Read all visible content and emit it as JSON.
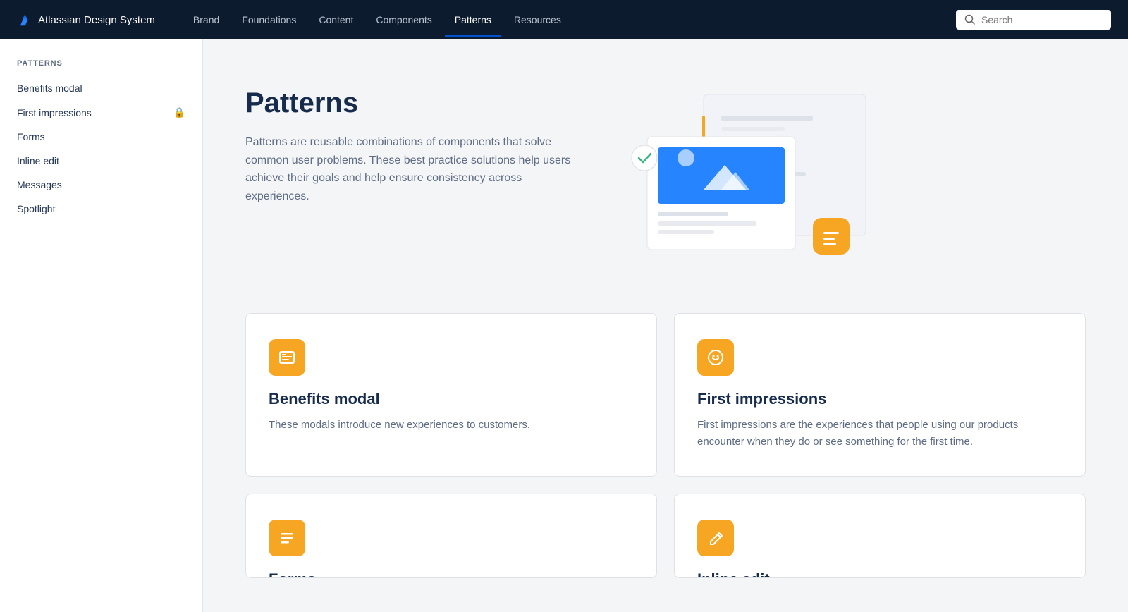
{
  "navbar": {
    "logo_text": "Atlassian Design System",
    "nav_items": [
      {
        "label": "Brand",
        "active": false
      },
      {
        "label": "Foundations",
        "active": false
      },
      {
        "label": "Content",
        "active": false
      },
      {
        "label": "Components",
        "active": false
      },
      {
        "label": "Patterns",
        "active": true
      },
      {
        "label": "Resources",
        "active": false
      }
    ],
    "search_placeholder": "Search"
  },
  "sidebar": {
    "section_label": "PATTERNS",
    "items": [
      {
        "label": "Benefits modal",
        "locked": false
      },
      {
        "label": "First impressions",
        "locked": true
      },
      {
        "label": "Forms",
        "locked": false
      },
      {
        "label": "Inline edit",
        "locked": false
      },
      {
        "label": "Messages",
        "locked": false
      },
      {
        "label": "Spotlight",
        "locked": false
      }
    ]
  },
  "hero": {
    "title": "Patterns",
    "description": "Patterns are reusable combinations of components that solve common user problems. These best practice solutions help users achieve their goals and help ensure consistency across experiences."
  },
  "cards": [
    {
      "icon": "🖥",
      "title": "Benefits modal",
      "description": "These modals introduce new experiences to customers."
    },
    {
      "icon": "😊",
      "title": "First impressions",
      "description": "First impressions are the experiences that people using our products encounter when they do or see something for the first time."
    },
    {
      "icon": "☰",
      "title": "Forms",
      "description": ""
    },
    {
      "icon": "✏",
      "title": "Inline edit",
      "description": ""
    }
  ],
  "colors": {
    "accent_yellow": "#f6a623",
    "nav_bg": "#0d1b2e",
    "active_blue": "#0052cc"
  }
}
